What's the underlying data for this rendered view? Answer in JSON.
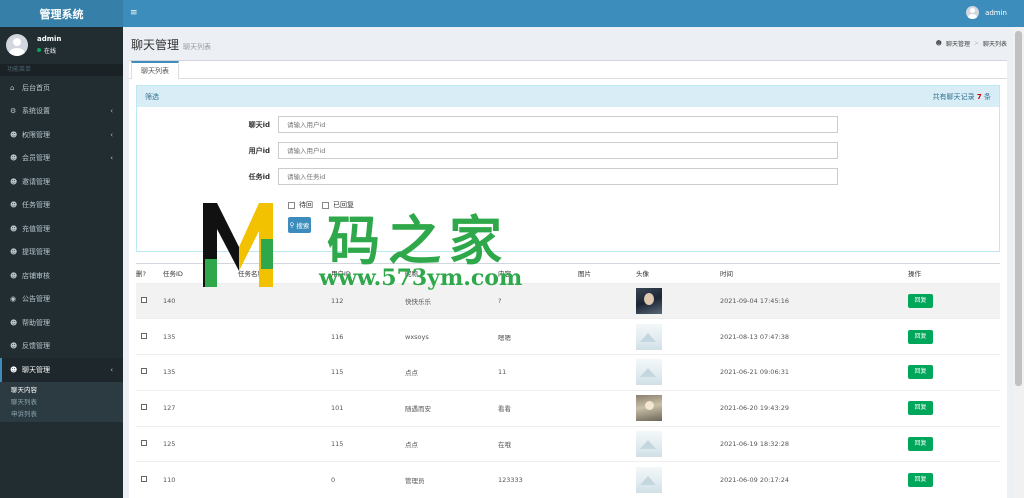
{
  "app": {
    "title": "管理系统"
  },
  "sidebar": {
    "user": {
      "name": "admin",
      "status": "在线"
    },
    "menu_header": "功能菜单",
    "items": [
      {
        "label": "后台首页",
        "icon": "home-icon",
        "glyph": "⌂",
        "caret": false
      },
      {
        "label": "系统设置",
        "icon": "gear-icon",
        "glyph": "⚙",
        "caret": true
      },
      {
        "label": "权限管理",
        "icon": "users-icon",
        "glyph": "☻",
        "caret": true
      },
      {
        "label": "会员管理",
        "icon": "users-icon",
        "glyph": "☻",
        "caret": true
      },
      {
        "label": "邀请管理",
        "icon": "users-icon",
        "glyph": "☻",
        "caret": false
      },
      {
        "label": "任务管理",
        "icon": "users-icon",
        "glyph": "☻",
        "caret": false
      },
      {
        "label": "充值管理",
        "icon": "users-icon",
        "glyph": "☻",
        "caret": false
      },
      {
        "label": "提现管理",
        "icon": "users-icon",
        "glyph": "☻",
        "caret": false
      },
      {
        "label": "店铺审核",
        "icon": "users-icon",
        "glyph": "☻",
        "caret": false
      },
      {
        "label": "公告管理",
        "icon": "globe-icon",
        "glyph": "◉",
        "caret": false
      },
      {
        "label": "帮助管理",
        "icon": "users-icon",
        "glyph": "☻",
        "caret": false
      },
      {
        "label": "反馈管理",
        "icon": "users-icon",
        "glyph": "☻",
        "caret": false
      },
      {
        "label": "聊天管理",
        "icon": "users-icon",
        "glyph": "☻",
        "caret": true
      }
    ],
    "submenu": [
      "聊天内容",
      "聊天列表",
      "申诉列表"
    ]
  },
  "navbar": {
    "menu_glyph": "≡",
    "user": "admin"
  },
  "header": {
    "title": "聊天管理",
    "subtitle": "聊天列表",
    "breadcrumb": [
      "聊天管理",
      "聊天列表"
    ],
    "breadcrumb_glyph": "☻",
    "breadcrumb_sep": ">"
  },
  "tab": {
    "label": "聊天列表"
  },
  "filter": {
    "title": "筛选",
    "count_prefix": "共有聊天记录",
    "count": "7",
    "count_suffix": "条",
    "fields": [
      {
        "label": "聊天id",
        "placeholder": "请输入用户id"
      },
      {
        "label": "用户id",
        "placeholder": "请输入用户id"
      },
      {
        "label": "任务id",
        "placeholder": "请输入任务id"
      }
    ],
    "checkboxes": [
      "待回",
      "已回复"
    ],
    "search_glyph": "⚲",
    "search_label": "搜索"
  },
  "watermark": {
    "chinese": "码之家",
    "url": "www.573ym.com"
  },
  "table": {
    "headers": [
      "删?",
      "任务ID",
      "任务名称",
      "用户ID",
      "昵称",
      "内容",
      "图片",
      "头像",
      "时间",
      "操作"
    ],
    "reply_label": "回复",
    "rows": [
      {
        "task_id": "140",
        "task_name": "",
        "user_id": "112",
        "nickname": "快快乐乐",
        "content": "?",
        "image": "",
        "avatar": "photo",
        "time": "2021-09-04 17:45:16"
      },
      {
        "task_id": "135",
        "task_name": "",
        "user_id": "116",
        "nickname": "wxsoys",
        "content": "嗯嗯",
        "image": "",
        "avatar": "placeholder",
        "time": "2021-08-13 07:47:38"
      },
      {
        "task_id": "135",
        "task_name": "",
        "user_id": "115",
        "nickname": "点点",
        "content": "11",
        "image": "",
        "avatar": "placeholder",
        "time": "2021-06-21 09:06:31"
      },
      {
        "task_id": "127",
        "task_name": "",
        "user_id": "101",
        "nickname": "随遇而安",
        "content": "看看",
        "image": "",
        "avatar": "photo2",
        "time": "2021-06-20 19:43:29"
      },
      {
        "task_id": "125",
        "task_name": "",
        "user_id": "115",
        "nickname": "点点",
        "content": "在哦",
        "image": "",
        "avatar": "placeholder",
        "time": "2021-06-19 18:32:28"
      },
      {
        "task_id": "110",
        "task_name": "",
        "user_id": "0",
        "nickname": "管理员",
        "content": "123333",
        "image": "",
        "avatar": "placeholder",
        "time": "2021-06-09 20:17:24"
      }
    ]
  },
  "colors": {
    "brand": "#3c8dbc",
    "sidebar": "#222d32",
    "success": "#00a65a",
    "watermark": "#2ea84a"
  }
}
